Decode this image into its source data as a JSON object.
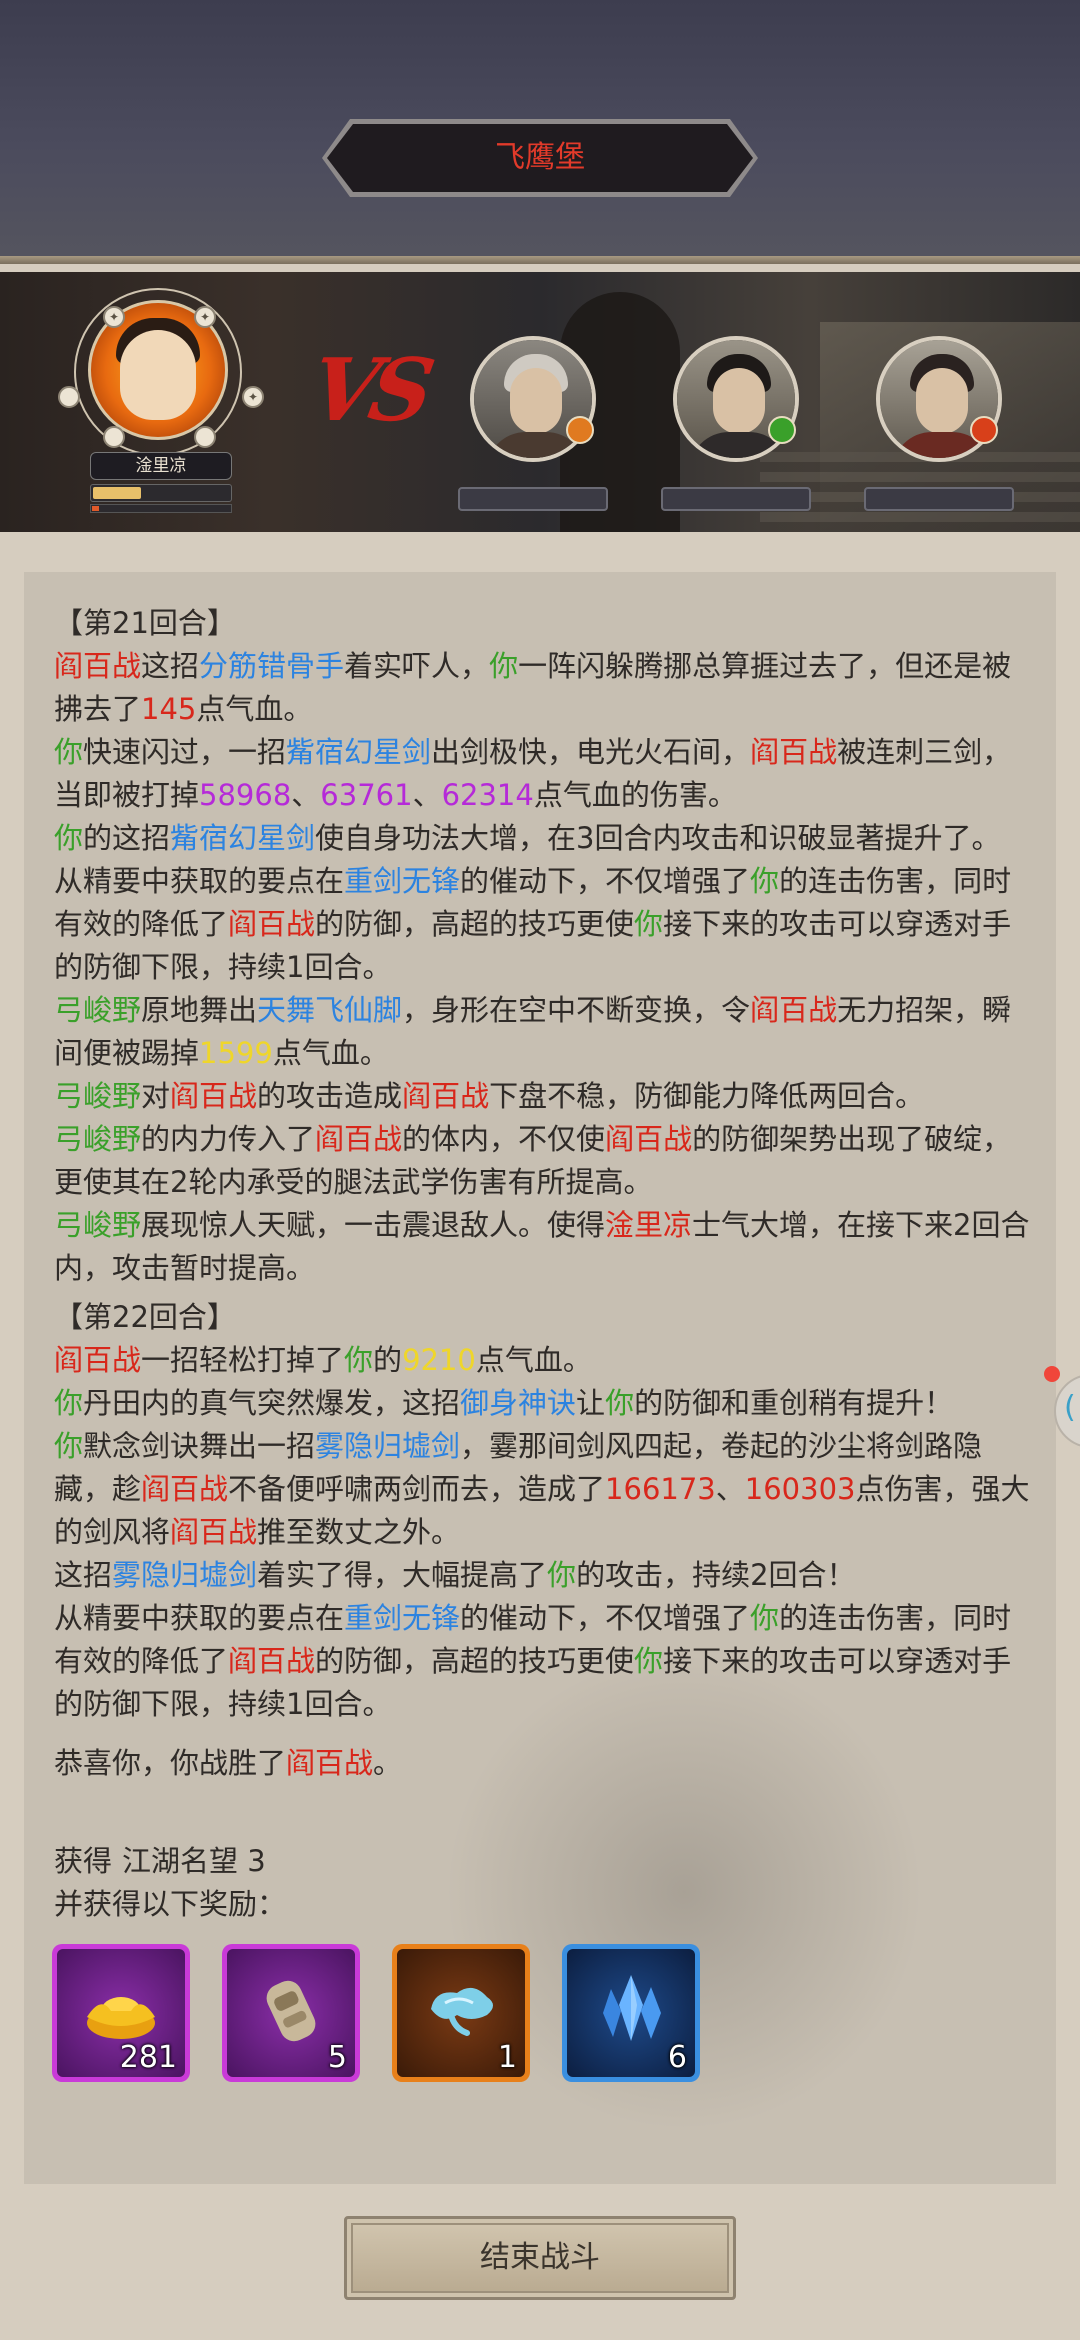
{
  "header": {
    "title": "飞鹰堡"
  },
  "battle": {
    "player": {
      "name": "淦里凉",
      "hp_fraction": 0.35,
      "mp_fraction": 0.05
    },
    "vs_label": "VS",
    "enemies": [
      {
        "name": "",
        "badge_color": "#e07a20"
      },
      {
        "name": "",
        "badge_color": "#3aa02a"
      },
      {
        "name": "",
        "badge_color": "#d8401a"
      }
    ]
  },
  "log": {
    "r21_title": "【第21回合】",
    "r21_l1": [
      {
        "t": "阎百战",
        "c": "red"
      },
      {
        "t": "这招"
      },
      {
        "t": "分筋错骨手",
        "c": "blue"
      },
      {
        "t": "着实吓人，"
      },
      {
        "t": "你",
        "c": "green"
      },
      {
        "t": "一阵闪躲腾挪总算捱过去了，但还是被拂去了"
      },
      {
        "t": "145",
        "c": "red"
      },
      {
        "t": "点气血。"
      }
    ],
    "r21_l2": [
      {
        "t": "你",
        "c": "green"
      },
      {
        "t": "快速闪过，一招"
      },
      {
        "t": "觜宿幻星剑",
        "c": "blue"
      },
      {
        "t": "出剑极快，电光火石间，"
      },
      {
        "t": "阎百战",
        "c": "red"
      },
      {
        "t": "被连刺三剑，当即被打掉"
      },
      {
        "t": "58968",
        "c": "purple"
      },
      {
        "t": "、"
      },
      {
        "t": "63761",
        "c": "purple"
      },
      {
        "t": "、"
      },
      {
        "t": "62314",
        "c": "purple"
      },
      {
        "t": "点气血的伤害。"
      }
    ],
    "r21_l3": [
      {
        "t": "你",
        "c": "green"
      },
      {
        "t": "的这招"
      },
      {
        "t": "觜宿幻星剑",
        "c": "blue"
      },
      {
        "t": "使自身功法大增，在3回合内攻击和识破显著提升了。"
      }
    ],
    "r21_l4": [
      {
        "t": "从精要中获取的要点在"
      },
      {
        "t": "重剑无锋",
        "c": "blue"
      },
      {
        "t": "的催动下，不仅增强了"
      },
      {
        "t": "你",
        "c": "green"
      },
      {
        "t": "的连击伤害，同时有效的降低了"
      },
      {
        "t": "阎百战",
        "c": "red"
      },
      {
        "t": "的防御，高超的技巧更使"
      },
      {
        "t": "你",
        "c": "green"
      },
      {
        "t": "接下来的攻击可以穿透对手的防御下限，持续1回合。"
      }
    ],
    "r21_l5": [
      {
        "t": "弓峻野",
        "c": "green"
      },
      {
        "t": "原地舞出"
      },
      {
        "t": "天舞飞仙脚",
        "c": "blue"
      },
      {
        "t": "，身形在空中不断变换，令"
      },
      {
        "t": "阎百战",
        "c": "red"
      },
      {
        "t": "无力招架，瞬间便被踢掉"
      },
      {
        "t": "1599",
        "c": "yellow"
      },
      {
        "t": "点气血。"
      }
    ],
    "r21_l6": [
      {
        "t": "弓峻野",
        "c": "green"
      },
      {
        "t": "对"
      },
      {
        "t": "阎百战",
        "c": "red"
      },
      {
        "t": "的攻击造成"
      },
      {
        "t": "阎百战",
        "c": "red"
      },
      {
        "t": "下盘不稳，防御能力降低两回合。"
      }
    ],
    "r21_l7": [
      {
        "t": "弓峻野",
        "c": "green"
      },
      {
        "t": "的内力传入了"
      },
      {
        "t": "阎百战",
        "c": "red"
      },
      {
        "t": "的体内，不仅使"
      },
      {
        "t": "阎百战",
        "c": "red"
      },
      {
        "t": "的防御架势出现了破绽，更使其在2轮内承受的腿法武学伤害有所提高。"
      }
    ],
    "r21_l8": [
      {
        "t": "弓峻野",
        "c": "green"
      },
      {
        "t": "展现惊人天赋，一击震退敌人。使得"
      },
      {
        "t": "淦里凉",
        "c": "red"
      },
      {
        "t": "士气大增，在接下来2回合内，攻击暂时提高。"
      }
    ],
    "r22_title": "【第22回合】",
    "r22_l1": [
      {
        "t": "阎百战",
        "c": "red"
      },
      {
        "t": "一招轻松打掉了"
      },
      {
        "t": "你",
        "c": "green"
      },
      {
        "t": "的"
      },
      {
        "t": "9210",
        "c": "yellow"
      },
      {
        "t": "点气血。"
      }
    ],
    "r22_l2": [
      {
        "t": "你",
        "c": "green"
      },
      {
        "t": "丹田内的真气突然爆发，这招"
      },
      {
        "t": "御身神诀",
        "c": "blue"
      },
      {
        "t": "让"
      },
      {
        "t": "你",
        "c": "green"
      },
      {
        "t": "的防御和重创稍有提升！"
      }
    ],
    "r22_l3": [
      {
        "t": "你",
        "c": "green"
      },
      {
        "t": "默念剑诀舞出一招"
      },
      {
        "t": "雾隐归墟剑",
        "c": "blue"
      },
      {
        "t": "，霎那间剑风四起，卷起的沙尘将剑路隐藏，趁"
      },
      {
        "t": "阎百战",
        "c": "red"
      },
      {
        "t": "不备便呼啸两剑而去，造成了"
      },
      {
        "t": "166173",
        "c": "red"
      },
      {
        "t": "、"
      },
      {
        "t": "160303",
        "c": "red"
      },
      {
        "t": "点伤害，强大的剑风将"
      },
      {
        "t": "阎百战",
        "c": "red"
      },
      {
        "t": "推至数丈之外。"
      }
    ],
    "r22_l4": [
      {
        "t": "这招"
      },
      {
        "t": "雾隐归墟剑",
        "c": "blue"
      },
      {
        "t": "着实了得，大幅提高了"
      },
      {
        "t": "你",
        "c": "green"
      },
      {
        "t": "的攻击，持续2回合！"
      }
    ],
    "r22_l5": [
      {
        "t": "从精要中获取的要点在"
      },
      {
        "t": "重剑无锋",
        "c": "blue"
      },
      {
        "t": "的催动下，不仅增强了"
      },
      {
        "t": "你",
        "c": "green"
      },
      {
        "t": "的连击伤害，同时有效的降低了"
      },
      {
        "t": "阎百战",
        "c": "red"
      },
      {
        "t": "的防御，高超的技巧更使"
      },
      {
        "t": "你",
        "c": "green"
      },
      {
        "t": "接下来的攻击可以穿透对手的防御下限，持续1回合。"
      }
    ],
    "victory": [
      {
        "t": "恭喜你，你战胜了"
      },
      {
        "t": "阎百战",
        "c": "red"
      },
      {
        "t": "。"
      }
    ]
  },
  "rewards": {
    "gain_label": "获得",
    "reputation_label": "江湖名望 3",
    "sub_label": "并获得以下奖励：",
    "items": [
      {
        "icon": "gold-ingot-icon",
        "count": "281",
        "rarity_color": "#c93ad8"
      },
      {
        "icon": "bone-relic-icon",
        "count": "5",
        "rarity_color": "#c93ad8"
      },
      {
        "icon": "cloud-wisp-icon",
        "count": "1",
        "rarity_color": "#e8801a"
      },
      {
        "icon": "blue-crystal-icon",
        "count": "6",
        "rarity_color": "#3a8fe0"
      }
    ]
  },
  "footer": {
    "end_button": "结束战斗"
  }
}
